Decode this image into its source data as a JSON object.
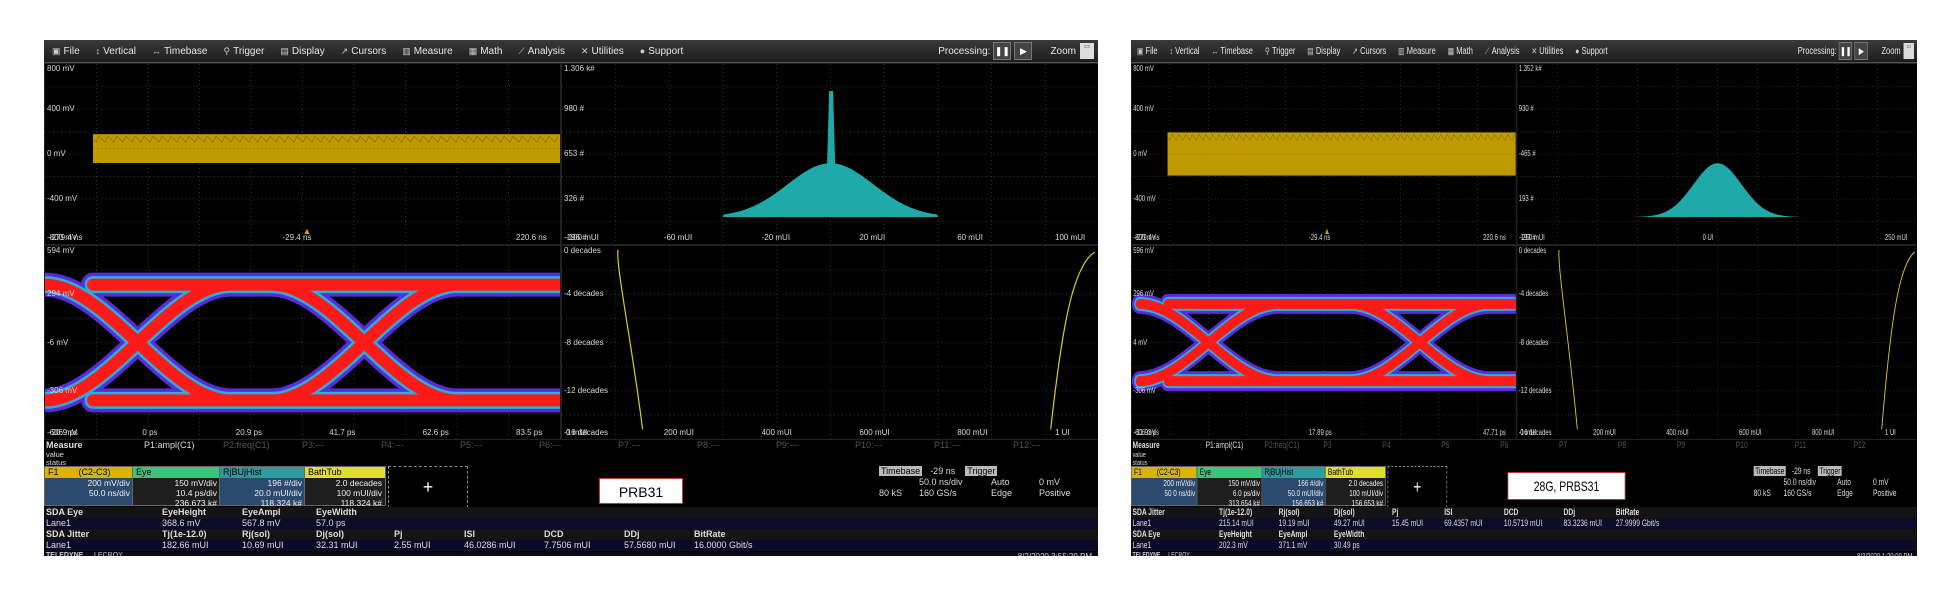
{
  "menu": {
    "file": "File",
    "vertical": "Vertical",
    "timebase": "Timebase",
    "trigger": "Trigger",
    "display": "Display",
    "cursors": "Cursors",
    "measure": "Measure",
    "math": "Math",
    "analysis": "Analysis",
    "utilities": "Utilities",
    "support": "Support",
    "processing": "Processing:",
    "zoom": "Zoom"
  },
  "panels": {
    "left": {
      "top_waveform": {
        "yticks": [
          "800 mV",
          "400 mV",
          "0 mV",
          "-400 mV",
          "-800 mV"
        ],
        "xticks": [
          "-279.4 ns",
          "-29.4 ns",
          "220.6 ns"
        ]
      },
      "histogram": {
        "yticks": [
          "1.306 k#",
          "980 #",
          "653 #",
          "326 #",
          "-196 #"
        ],
        "xticks": [
          "-100 mUI",
          "-60 mUI",
          "-20 mUI",
          "20 mUI",
          "60 mUI",
          "100 mUI"
        ]
      },
      "eye": {
        "yticks": [
          "594 mV",
          "294 mV",
          "-6 mV",
          "-306 mV",
          "-606 mV"
        ],
        "xticks": [
          "-20.9 ps",
          "0 ps",
          "20.9 ps",
          "41.7 ps",
          "62.6 ps",
          "83.5 ps"
        ]
      },
      "bathtub": {
        "yticks": [
          "0 decades",
          "-4 decades",
          "-8 decades",
          "-12 decades",
          "-16 decades"
        ],
        "xticks": [
          "0 mUI",
          "200 mUI",
          "400 mUI",
          "600 mUI",
          "800 mUI",
          "1 UI"
        ]
      }
    },
    "right": {
      "top_waveform": {
        "yticks": [
          "800 mV",
          "400 mV",
          "0 mV",
          "-400 mV",
          "-800 mV"
        ],
        "xticks": [
          "-279.4 ns",
          "-29.4 ns",
          "220.6 ns"
        ]
      },
      "histogram": {
        "yticks": [
          "1.352 k#",
          "930 #",
          "-465 #",
          "193 #",
          "-193 #"
        ],
        "xticks": [
          "-250 mUI",
          "0 UI",
          "250 mUI"
        ]
      },
      "eye": {
        "yticks": [
          "596 mV",
          "296 mV",
          "4 mV",
          "-306 mV",
          "-606 mV"
        ],
        "xticks": [
          "-11.93 ps",
          "17.89 ps",
          "47.71 ps"
        ]
      },
      "bathtub": {
        "yticks": [
          "0 decades",
          "-4 decades",
          "-8 decades",
          "-12 decades",
          "-16 decades"
        ],
        "xticks": [
          "0 mUI",
          "200 mUI",
          "400 mUI",
          "600 mUI",
          "800 mUI",
          "1 UI"
        ]
      }
    }
  },
  "measure": {
    "label": "Measure",
    "value": "value",
    "status": "status",
    "params_left": [
      "P1:ampl(C1)",
      "P2:freq(C1)",
      "P3:---",
      "P4:---",
      "P5:---",
      "P6:---",
      "P7:---",
      "P8:---",
      "P9:---",
      "P10:---",
      "P11:---",
      "P12:---"
    ],
    "params_right": [
      "P1:ampl(C1)",
      "P2:freq(C1)",
      "P3",
      "P4",
      "P5",
      "P6",
      "P7",
      "P8",
      "P9",
      "P10",
      "P11",
      "P12"
    ]
  },
  "descriptors": {
    "left": {
      "f1": {
        "title": "F1",
        "src": "(C2-C3)",
        "lines": [
          "200 mV/div",
          "50.0 ns/div"
        ]
      },
      "eye": {
        "title": "Eye",
        "lines": [
          "150 mV/div",
          "10.4 ps/div",
          "236.673 k#"
        ]
      },
      "rj": {
        "title": "RjBUjHist",
        "lines": [
          "196 #/div",
          "20.0 mUI/div",
          "118.324 k#"
        ]
      },
      "bath": {
        "title": "BathTub",
        "lines": [
          "2.0 decades",
          "100 mUI/div",
          "118.324 k#"
        ]
      }
    },
    "right": {
      "f1": {
        "title": "F1",
        "src": "(C2-C3)",
        "lines": [
          "200 mV/div",
          "50 0 ns/div"
        ]
      },
      "eye": {
        "title": "Eye",
        "lines": [
          "150 mV/div",
          "6.0 ps/div",
          "313.654 k#"
        ]
      },
      "rj": {
        "title": "RjBUjHist",
        "lines": [
          "166 #/div",
          "50.0 mUI/div",
          "156.653 k#"
        ]
      },
      "bath": {
        "title": "BathTub",
        "lines": [
          "2.0 decades",
          "100 mUI/div",
          "156.653 k#"
        ]
      }
    }
  },
  "add_button": "+",
  "tags": {
    "left": "PRB31",
    "right": "28G, PRBS31"
  },
  "timebase": {
    "left": {
      "tb_label": "Timebase",
      "tb_delay": "-29 ns",
      "trig_label": "Trigger",
      "rows": [
        [
          "",
          "50.0 ns/div",
          "Auto",
          "0 mV"
        ],
        [
          "80 kS",
          "160 GS/s",
          "Edge",
          "Positive"
        ]
      ]
    },
    "right": {
      "tb_label": "Timebase",
      "tb_delay": "-29 ns",
      "trig_label": "Trigger",
      "rows": [
        [
          "",
          "50.0 ns/div",
          "Auto",
          "0 mV"
        ],
        [
          "80 kS",
          "160 GS/s",
          "Edge",
          "Positive"
        ]
      ]
    }
  },
  "results": {
    "left": {
      "eye_hdr": [
        "SDA Eye",
        "EyeHeight",
        "EyeAmpl",
        "EyeWidth"
      ],
      "eye_row": [
        "Lane1",
        "368.6 mV",
        "567.8 mV",
        "57.0 ps"
      ],
      "jit_hdr": [
        "SDA Jitter",
        "Tj(1e-12.0)",
        "Rj(sol)",
        "Dj(sol)",
        "Pj",
        "ISI",
        "DCD",
        "DDj",
        "BitRate"
      ],
      "jit_row": [
        "Lane1",
        "182.66 mUI",
        "10.69 mUI",
        "32.31 mUI",
        "2.55 mUI",
        "46.0286 mUI",
        "7.7506 mUI",
        "57.5680 mUI",
        "16.0000 Gbit/s"
      ]
    },
    "right": {
      "jit_hdr": [
        "SDA Jitter",
        "Tj(1e-12.0)",
        "Rj(sol)",
        "Dj(sol)",
        "Pj",
        "ISI",
        "DCD",
        "DDj",
        "BitRate"
      ],
      "jit_row": [
        "Lane1",
        "215.14 mUI",
        "19.19 mUI",
        "49.27 mUI",
        "15.45 mUI",
        "69.4357 mUI",
        "10.5719 mUI",
        "83.3236 mUI",
        "27.9999 Gbit/s"
      ],
      "eye_hdr": [
        "SDA Eye",
        "EyeHeight",
        "EyeAmpl",
        "EyeWidth"
      ],
      "eye_row": [
        "Lane1",
        "202.3 mV",
        "371.1 mV",
        "30.49 ps"
      ]
    }
  },
  "footer": {
    "brand": "TELEDYNE",
    "brand2": "LECROY",
    "left_date": "8/2/2020 3:55:29 PM",
    "right_date": "8/3/2020 1:20:09 PM"
  },
  "colors": {
    "waveform": "#c9a300",
    "histogram": "#1fa9a9",
    "eye_outer": "#5a2bd8",
    "eye_inner": "#ff1a1a",
    "bathtub": "#d8cc2a",
    "f1_hdr": "#d9b400",
    "eye_hdr": "#38c77a",
    "rj_hdr": "#2a9d9d",
    "bath_hdr": "#e0de2c"
  }
}
